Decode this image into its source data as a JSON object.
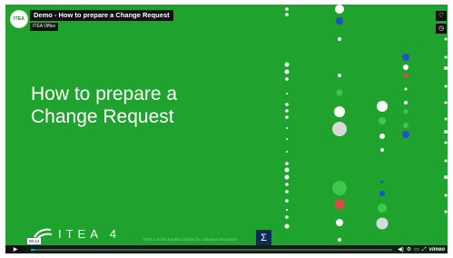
{
  "video": {
    "title": "Demo - How to prepare a Change Request",
    "owner": "ITEA Office",
    "channel_logo_text": "ITEA",
    "playback_progress": 0.01
  },
  "slide": {
    "heading_line1": "How to prepare a",
    "heading_line2": "Change Request",
    "brand": "ITEA 4",
    "footer_text": "ITEA 4 is the Eureka Cluster for software innovation",
    "sigma": "Σ",
    "background_color": "#20a22e"
  },
  "side_buttons": {
    "icons": [
      "heart-icon",
      "clock-icon"
    ],
    "heart_glyph": "♡",
    "clock_glyph": "◷"
  },
  "controls": {
    "play_glyph": "▶",
    "time": "00:14",
    "volume_glyph": "◀)",
    "settings_glyph": "⚙",
    "pip_glyph": "▭",
    "fullscreen_glyph": "⤢",
    "logo": "vimeo",
    "accent_color": "#00adef"
  }
}
